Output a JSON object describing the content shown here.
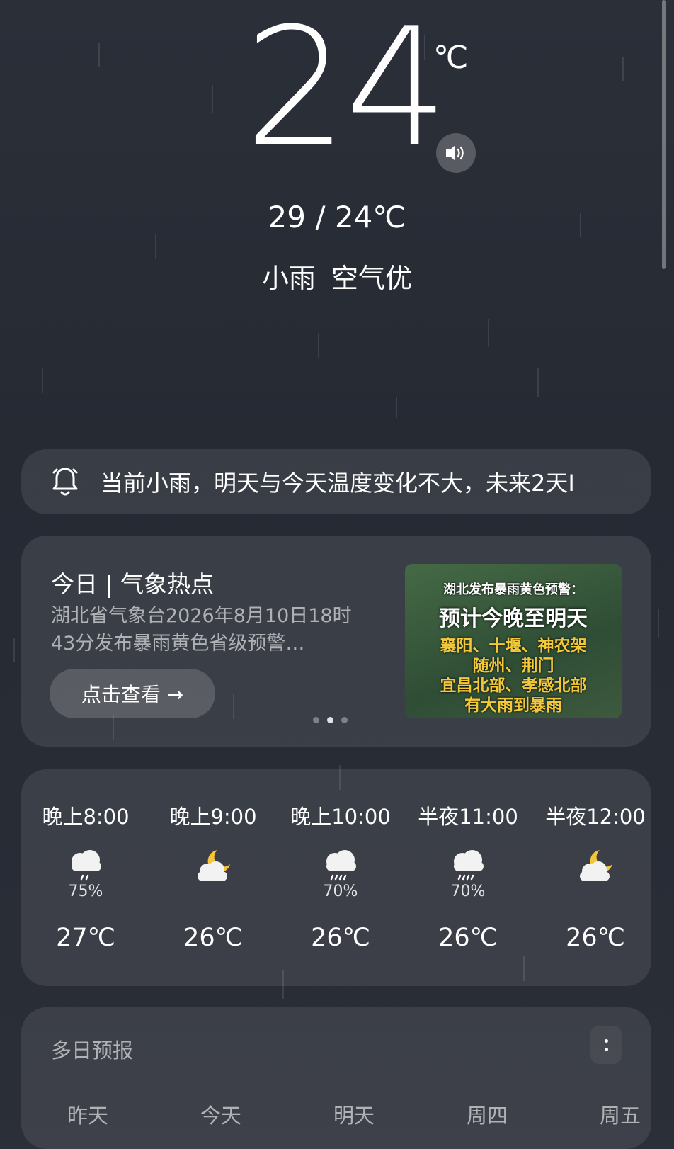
{
  "current": {
    "temperature": "24",
    "unit": "℃",
    "range": "29 / 24℃",
    "condition": "小雨",
    "air_quality": "空气优"
  },
  "alert": {
    "icon": "bell-icon",
    "text": "当前小雨，明天与今天温度变化不大，未来2天I"
  },
  "news": {
    "title": "今日 | 气象热点",
    "description": "湖北省气象台2026年8月10日18时43分发布暴雨黄色省级预警…",
    "button_label": "点击查看 →",
    "image": {
      "line1": "湖北发布暴雨黄色预警：",
      "line2": "预计今晚至明天",
      "line3": "襄阳、十堰、神农架",
      "line4": "随州、荆门",
      "line5": "宜昌北部、孝感北部",
      "line6": "有大雨到暴雨"
    },
    "page_count": 3,
    "active_page": 2
  },
  "hourly": [
    {
      "time": "晚上8:00",
      "icon": "light-rain-icon",
      "pop": "75%",
      "temp": "27℃"
    },
    {
      "time": "晚上9:00",
      "icon": "partly-cloudy-night-icon",
      "pop": "",
      "temp": "26℃"
    },
    {
      "time": "晚上10:00",
      "icon": "rain-icon",
      "pop": "70%",
      "temp": "26℃"
    },
    {
      "time": "半夜11:00",
      "icon": "rain-icon",
      "pop": "70%",
      "temp": "26℃"
    },
    {
      "time": "半夜12:00",
      "icon": "partly-cloudy-night-icon",
      "pop": "",
      "temp": "26℃"
    }
  ],
  "daily": {
    "title": "多日预报",
    "days": [
      "昨天",
      "今天",
      "明天",
      "周四",
      "周五"
    ]
  }
}
